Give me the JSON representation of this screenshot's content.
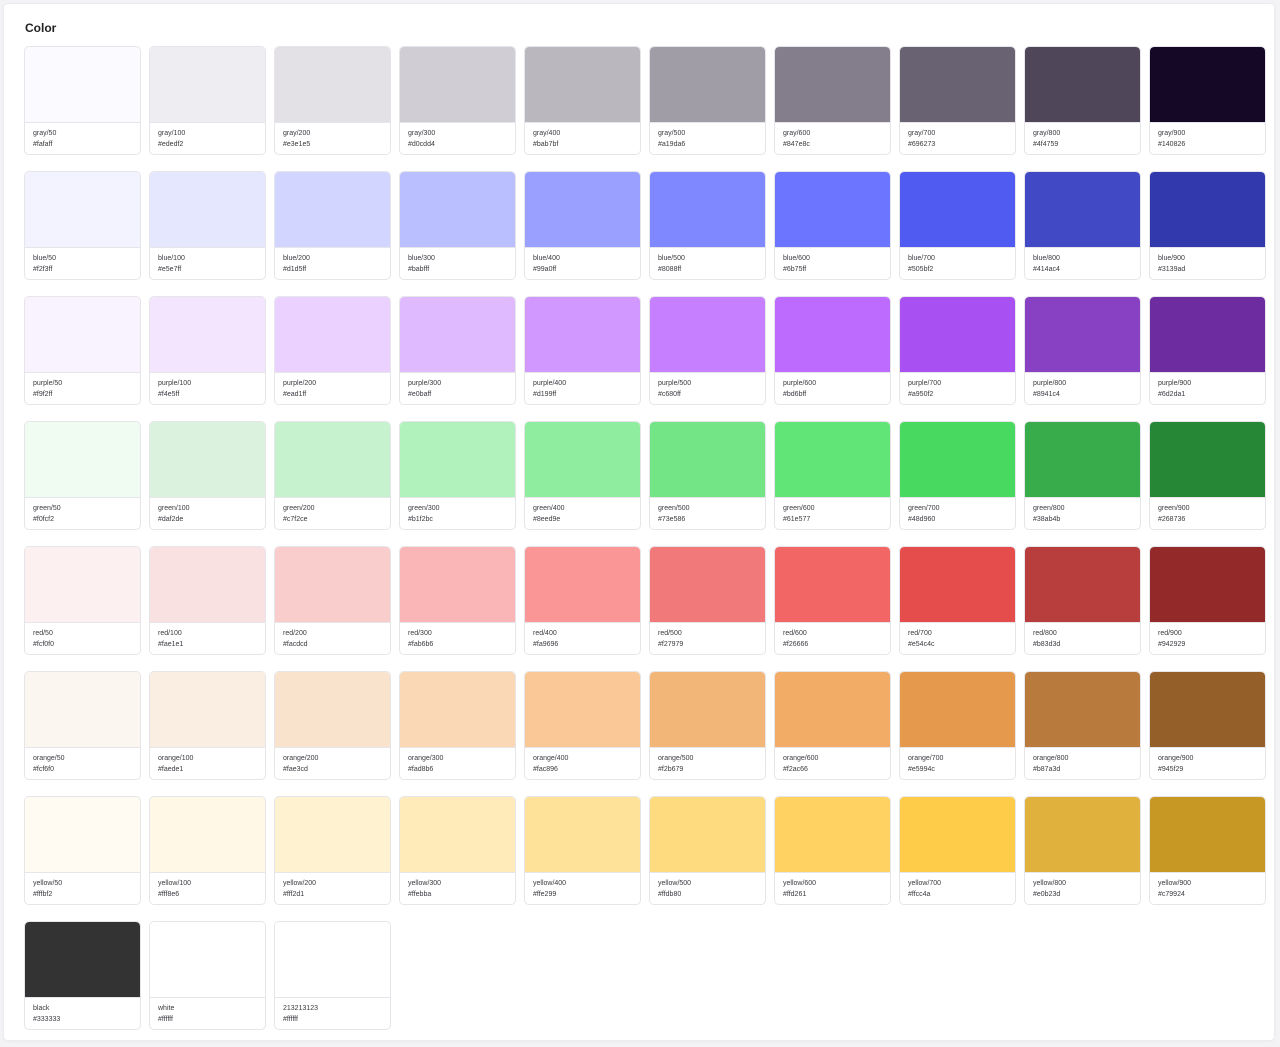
{
  "section_title": "Color",
  "palette": [
    {
      "name": "gray/50",
      "hex": "#fafaff",
      "color": "#fafaff"
    },
    {
      "name": "gray/100",
      "hex": "#ededf2",
      "color": "#ededf2"
    },
    {
      "name": "gray/200",
      "hex": "#e3e1e5",
      "color": "#e3e1e5"
    },
    {
      "name": "gray/300",
      "hex": "#d0cdd4",
      "color": "#d0cdd4"
    },
    {
      "name": "gray/400",
      "hex": "#bab7bf",
      "color": "#bab7bf"
    },
    {
      "name": "gray/500",
      "hex": "#a19da6",
      "color": "#a19da6"
    },
    {
      "name": "gray/600",
      "hex": "#847e8c",
      "color": "#847e8c"
    },
    {
      "name": "gray/700",
      "hex": "#696273",
      "color": "#696273"
    },
    {
      "name": "gray/800",
      "hex": "#4f4759",
      "color": "#4f4759"
    },
    {
      "name": "gray/900",
      "hex": "#140826",
      "color": "#140826"
    },
    {
      "name": "blue/50",
      "hex": "#f2f3ff",
      "color": "#f2f3ff"
    },
    {
      "name": "blue/100",
      "hex": "#e5e7ff",
      "color": "#e5e7ff"
    },
    {
      "name": "blue/200",
      "hex": "#d1d5ff",
      "color": "#d1d5ff"
    },
    {
      "name": "blue/300",
      "hex": "#babfff",
      "color": "#babfff"
    },
    {
      "name": "blue/400",
      "hex": "#99a0ff",
      "color": "#99a0ff"
    },
    {
      "name": "blue/500",
      "hex": "#8088ff",
      "color": "#8088ff"
    },
    {
      "name": "blue/600",
      "hex": "#6b75ff",
      "color": "#6b75ff"
    },
    {
      "name": "blue/700",
      "hex": "#505bf2",
      "color": "#505bf2"
    },
    {
      "name": "blue/800",
      "hex": "#414ac4",
      "color": "#414ac4"
    },
    {
      "name": "blue/900",
      "hex": "#3139ad",
      "color": "#3139ad"
    },
    {
      "name": "purple/50",
      "hex": "#f9f2ff",
      "color": "#f9f2ff"
    },
    {
      "name": "purple/100",
      "hex": "#f4e5ff",
      "color": "#f4e5ff"
    },
    {
      "name": "purple/200",
      "hex": "#ead1ff",
      "color": "#ead1ff"
    },
    {
      "name": "purple/300",
      "hex": "#e0baff",
      "color": "#e0baff"
    },
    {
      "name": "purple/400",
      "hex": "#d199ff",
      "color": "#d199ff"
    },
    {
      "name": "purple/500",
      "hex": "#c680ff",
      "color": "#c680ff"
    },
    {
      "name": "purple/600",
      "hex": "#bd6bff",
      "color": "#bd6bff"
    },
    {
      "name": "purple/700",
      "hex": "#a950f2",
      "color": "#a950f2"
    },
    {
      "name": "purple/800",
      "hex": "#8941c4",
      "color": "#8941c4"
    },
    {
      "name": "purple/900",
      "hex": "#6d2da1",
      "color": "#6d2da1"
    },
    {
      "name": "green/50",
      "hex": "#f0fcf2",
      "color": "#f0fcf2"
    },
    {
      "name": "green/100",
      "hex": "#daf2de",
      "color": "#daf2de"
    },
    {
      "name": "green/200",
      "hex": "#c7f2ce",
      "color": "#c7f2ce"
    },
    {
      "name": "green/300",
      "hex": "#b1f2bc",
      "color": "#b1f2bc"
    },
    {
      "name": "green/400",
      "hex": "#8eed9e",
      "color": "#8eed9e"
    },
    {
      "name": "green/500",
      "hex": "#73e586",
      "color": "#73e586"
    },
    {
      "name": "green/600",
      "hex": "#61e577",
      "color": "#61e577"
    },
    {
      "name": "green/700",
      "hex": "#48d960",
      "color": "#48d960"
    },
    {
      "name": "green/800",
      "hex": "#38ab4b",
      "color": "#38ab4b"
    },
    {
      "name": "green/900",
      "hex": "#268736",
      "color": "#268736"
    },
    {
      "name": "red/50",
      "hex": "#fcf0f0",
      "color": "#fcf0f0"
    },
    {
      "name": "red/100",
      "hex": "#fae1e1",
      "color": "#fae1e1"
    },
    {
      "name": "red/200",
      "hex": "#facdcd",
      "color": "#facdcd"
    },
    {
      "name": "red/300",
      "hex": "#fab6b6",
      "color": "#fab6b6"
    },
    {
      "name": "red/400",
      "hex": "#fa9696",
      "color": "#fa9696"
    },
    {
      "name": "red/500",
      "hex": "#f27979",
      "color": "#f27979"
    },
    {
      "name": "red/600",
      "hex": "#f26666",
      "color": "#f26666"
    },
    {
      "name": "red/700",
      "hex": "#e54c4c",
      "color": "#e54c4c"
    },
    {
      "name": "red/800",
      "hex": "#b83d3d",
      "color": "#b83d3d"
    },
    {
      "name": "red/900",
      "hex": "#942929",
      "color": "#942929"
    },
    {
      "name": "orange/50",
      "hex": "#fcf6f0",
      "color": "#fcf6f0"
    },
    {
      "name": "orange/100",
      "hex": "#faede1",
      "color": "#faede1"
    },
    {
      "name": "orange/200",
      "hex": "#fae3cd",
      "color": "#fae3cd"
    },
    {
      "name": "orange/300",
      "hex": "#fad8b6",
      "color": "#fad8b6"
    },
    {
      "name": "orange/400",
      "hex": "#fac896",
      "color": "#fac896"
    },
    {
      "name": "orange/500",
      "hex": "#f2b679",
      "color": "#f2b679"
    },
    {
      "name": "orange/600",
      "hex": "#f2ac66",
      "color": "#f2ac66"
    },
    {
      "name": "orange/700",
      "hex": "#e5994c",
      "color": "#e5994c"
    },
    {
      "name": "orange/800",
      "hex": "#b87a3d",
      "color": "#b87a3d"
    },
    {
      "name": "orange/900",
      "hex": "#945f29",
      "color": "#945f29"
    },
    {
      "name": "yellow/50",
      "hex": "#fffbf2",
      "color": "#fffbf2"
    },
    {
      "name": "yellow/100",
      "hex": "#fff8e6",
      "color": "#fff8e6"
    },
    {
      "name": "yellow/200",
      "hex": "#fff2d1",
      "color": "#fff2d1"
    },
    {
      "name": "yellow/300",
      "hex": "#ffebba",
      "color": "#ffebba"
    },
    {
      "name": "yellow/400",
      "hex": "#ffe299",
      "color": "#ffe299"
    },
    {
      "name": "yellow/500",
      "hex": "#ffdb80",
      "color": "#ffdb80"
    },
    {
      "name": "yellow/600",
      "hex": "#ffd261",
      "color": "#ffd261"
    },
    {
      "name": "yellow/700",
      "hex": "#ffcc4a",
      "color": "#ffcc4a"
    },
    {
      "name": "yellow/800",
      "hex": "#e0b23d",
      "color": "#e0b23d"
    },
    {
      "name": "yellow/900",
      "hex": "#c79924",
      "color": "#c79924"
    },
    {
      "name": "black",
      "hex": "#333333",
      "color": "#333333"
    },
    {
      "name": "white",
      "hex": "#ffffff",
      "color": "#ffffff"
    },
    {
      "name": "213213123",
      "hex": "#ffffff",
      "color": "#ffffff"
    }
  ]
}
